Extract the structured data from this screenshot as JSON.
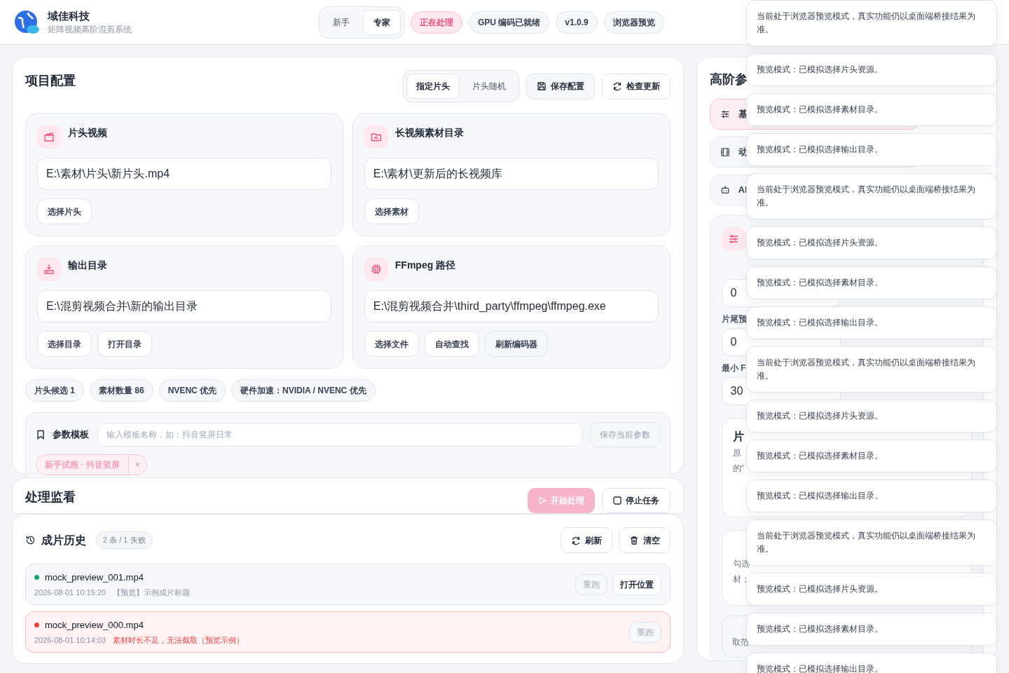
{
  "header": {
    "brand": "域佳科技",
    "subtitle": "矩阵视频高阶混剪系统",
    "modes": [
      {
        "label": "新手",
        "selected": false
      },
      {
        "label": "专家",
        "selected": true
      }
    ],
    "badges": [
      {
        "label": "正在处理",
        "kind": "active"
      },
      {
        "label": "GPU 编码已就绪",
        "kind": "plain"
      },
      {
        "label": "v1.0.9",
        "kind": "plain"
      },
      {
        "label": "浏览器预览",
        "kind": "plain"
      }
    ]
  },
  "project": {
    "title": "项目配置",
    "pick_modes": [
      {
        "label": "指定片头",
        "selected": true
      },
      {
        "label": "片头随机",
        "selected": false
      }
    ],
    "actions": [
      "保存配置",
      "检查更新"
    ],
    "cards": [
      {
        "title": "片头视频",
        "value": "E:\\素材\\片头\\新片头.mp4",
        "buttons": [
          "选择片头"
        ]
      },
      {
        "title": "长视频素材目录",
        "value": "E:\\素材\\更新后的长视频库",
        "buttons": [
          "选择素材"
        ]
      },
      {
        "title": "输出目录",
        "value": "E:\\混剪视频合并\\新的输出目录",
        "buttons": [
          "选择目录",
          "打开目录"
        ]
      },
      {
        "title": "FFmpeg 路径",
        "value": "E:\\混剪视频合并\\third_party\\ffmpeg\\ffmpeg.exe",
        "buttons": [
          "选择文件",
          "自动查找",
          "刷新编码器"
        ]
      }
    ],
    "chips": [
      "片头候选 1",
      "素材数量 86",
      "NVENC 优先",
      "硬件加速：NVIDIA / NVENC 优先"
    ],
    "templates": {
      "label": "参数模板",
      "placeholder": "输入模板名称，如：抖音竖屏日常",
      "save": {
        "label": "保存当前参数",
        "disabled": true
      },
      "items": [
        {
          "label": "新手试跑 · 抖音竖屏",
          "remove": "×"
        }
      ]
    }
  },
  "monitor": {
    "title": "处理监看",
    "start": {
      "label": "开始处理",
      "disabled": true
    },
    "stop": {
      "label": "停止任务",
      "disabled": false
    }
  },
  "history": {
    "title": "成片历史",
    "count": "2 条 / 1 失败",
    "actions": [
      "刷新",
      "清空"
    ],
    "rows": [
      {
        "name": "mock_preview_001.mp4",
        "time": "2026-08-01 10:15:20",
        "note": "【预览】示例成片标题",
        "failed": false,
        "buttons": [
          {
            "label": "重跑",
            "disabled": true
          },
          {
            "label": "打开位置",
            "disabled": false
          }
        ]
      },
      {
        "name": "mock_preview_000.mp4",
        "time": "2026-08-01 10:14:03",
        "note": "素材时长不足，无法截取（预览示例）",
        "failed": true,
        "buttons": [
          {
            "label": "重跑",
            "disabled": true
          }
        ]
      }
    ]
  },
  "advanced": {
    "title": "高阶参",
    "tabs": [
      {
        "label": "基",
        "selected": true
      },
      {
        "label": "动",
        "selected": false
      },
      {
        "label": "AI",
        "selected": false
      }
    ],
    "fields": [
      {
        "value": "0"
      },
      {
        "label": "片尾预",
        "value": "0"
      },
      {
        "label": "最小 F",
        "value": "30"
      }
    ],
    "option_card": {
      "title": "片",
      "lines": [
        "原",
        "的“"
      ]
    },
    "check_card": {
      "lines": [
        "勾选",
        "材；"
      ]
    },
    "note": "取范"
  },
  "toasts": [
    {
      "text": "当前处于浏览器预览模式，真实功能仍以桌面端桥接结果为准。"
    },
    {
      "text": "预览模式：已模拟选择片头资源。"
    },
    {
      "text": "预览模式：已模拟选择素材目录。"
    },
    {
      "text": "预览模式：已模拟选择输出目录。"
    },
    {
      "text": "当前处于浏览器预览模式，真实功能仍以桌面端桥接结果为准。"
    },
    {
      "text": "预览模式：已模拟选择片头资源。"
    },
    {
      "text": "预览模式：已模拟选择素材目录。"
    },
    {
      "text": "预览模式：已模拟选择输出目录。"
    },
    {
      "text": "当前处于浏览器预览模式，真实功能仍以桌面端桥接结果为准。"
    },
    {
      "text": "预览模式：已模拟选择片头资源。"
    },
    {
      "text": "预览模式：已模拟选择素材目录。"
    },
    {
      "text": "预览模式：已模拟选择输出目录。"
    },
    {
      "text": "当前处于浏览器预览模式，真实功能仍以桌面端桥接结果为准。"
    },
    {
      "text": "预览模式：已模拟选择片头资源。"
    },
    {
      "text": "预览模式：已模拟选择素材目录。"
    },
    {
      "text": "预览模式：已模拟选择输出目录。"
    }
  ]
}
